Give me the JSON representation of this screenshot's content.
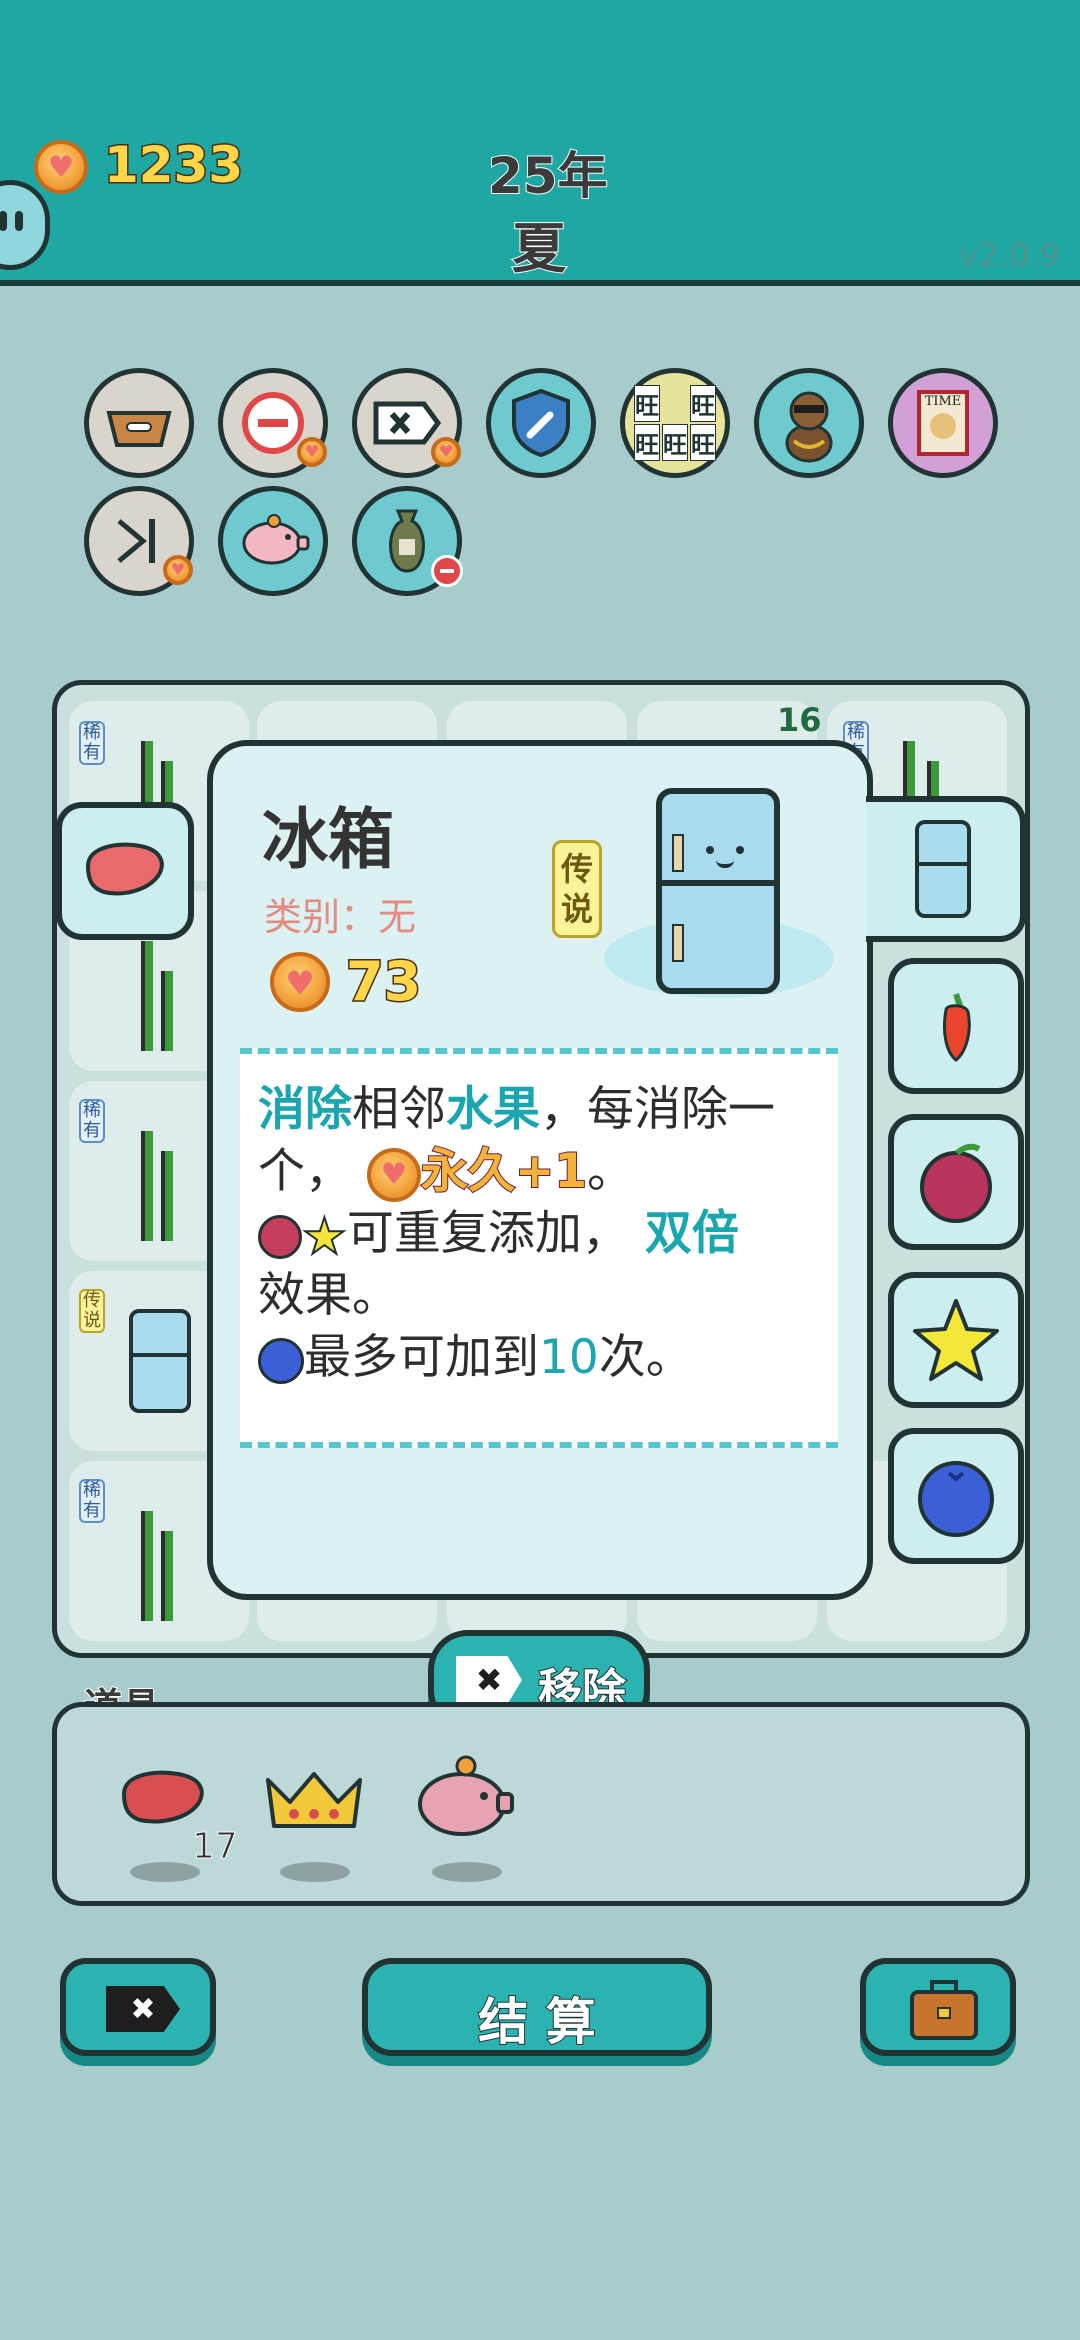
{
  "header": {
    "coins": "1233",
    "year": "25年",
    "season": "夏",
    "version": "v2.0.9"
  },
  "badges": [
    {
      "icon": "pet-food-bowl-icon"
    },
    {
      "icon": "minus-circle-icon"
    },
    {
      "icon": "remove-tag-icon"
    },
    {
      "icon": "wrench-shield-icon"
    },
    {
      "icon": "wang-tiles-icon",
      "glyph": "旺"
    },
    {
      "icon": "dog-with-sunglasses-icon"
    },
    {
      "icon": "time-magazine-icon",
      "glyph": "TIME"
    },
    {
      "icon": "skip-icon"
    },
    {
      "icon": "piggy-bank-icon"
    },
    {
      "icon": "sack-icon"
    }
  ],
  "board": {
    "counter": "16",
    "tags": {
      "rare": "稀有",
      "legend": "传说"
    }
  },
  "popup": {
    "title": "冰箱",
    "category": "类别：无",
    "rarity": "传说",
    "value": "73",
    "desc": {
      "l1a": "消除",
      "l1b": "相邻",
      "l1c": "水果",
      "l1d": "，每消除一",
      "l2a": "个，",
      "l2b": "永久+1",
      "l2c": "。",
      "l3a": "可重复添加，",
      "l3b": "双倍",
      "l4": "效果。",
      "l5a": "最多可加到",
      "l5b": "10",
      "l5c": "次。"
    }
  },
  "remove_button": {
    "label": "移除"
  },
  "items": {
    "title": "道具",
    "liver_count": "17"
  },
  "bottom": {
    "settle_label": "结 算"
  },
  "colors": {
    "teal": "#1fa7a4",
    "highlight": "#1aa6ae",
    "outline": "#213333",
    "gold": "#ffd54a"
  }
}
